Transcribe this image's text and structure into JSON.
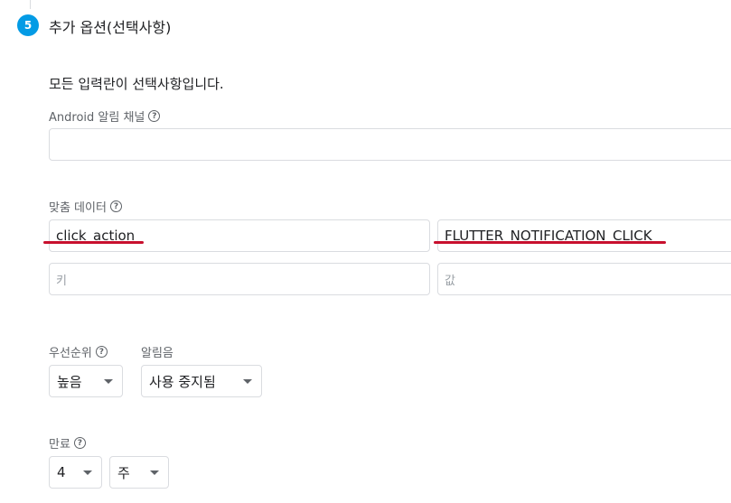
{
  "step": {
    "number": "5",
    "title": "추가 옵션(선택사항)"
  },
  "intro": "모든 입력란이 선택사항입니다.",
  "android_channel": {
    "label": "Android 알림 채널",
    "value": ""
  },
  "custom_data": {
    "label": "맞춤 데이터",
    "rows": [
      {
        "key": "click_action",
        "value": "FLUTTER_NOTIFICATION_CLICK"
      }
    ],
    "key_placeholder": "키",
    "value_placeholder": "값"
  },
  "priority": {
    "label": "우선순위",
    "selected": "높음"
  },
  "sound": {
    "label": "알림음",
    "selected": "사용 중지됨"
  },
  "expiry": {
    "label": "만료",
    "amount": "4",
    "unit": "주"
  },
  "colors": {
    "accent": "#039be5",
    "annotation": "#c8102e"
  }
}
